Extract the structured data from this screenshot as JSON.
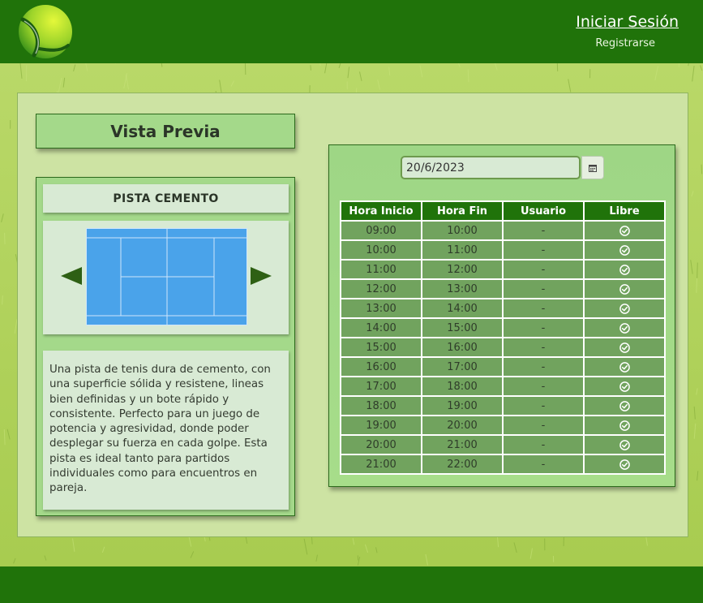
{
  "header": {
    "login_label": "Iniciar Sesión",
    "register_label": "Registrarse",
    "logo_icon": "tennis-ball-icon"
  },
  "colors": {
    "header_bg": "#20730a",
    "panel_bg": "#cde3a3",
    "card_bg": "#a4d98a",
    "table_header_bg": "#20730a",
    "table_cell_bg": "#71a35e",
    "court_blue": "#4aa3ea"
  },
  "preview": {
    "title": "Vista Previa",
    "court_name": "PISTA CEMENTO",
    "description": "Una pista de tenis dura de cemento, con una superficie sólida y resistene, lineas bien definidas y un bote rápido y consistente. Perfecto para un juego de potencia y agresividad, donde poder desplegar su fuerza en cada golpe. Esta pista es ideal tanto para partidos individuales como para encuentros en pareja.",
    "prev_icon": "arrow-left-icon",
    "next_icon": "arrow-right-icon"
  },
  "schedule": {
    "date_value": "20/6/2023",
    "calendar_icon": "calendar-icon",
    "columns": [
      "Hora Inicio",
      "Hora Fin",
      "Usuario",
      "Libre"
    ],
    "rows": [
      {
        "start": "09:00",
        "end": "10:00",
        "user": "-",
        "free": true
      },
      {
        "start": "10:00",
        "end": "11:00",
        "user": "-",
        "free": true
      },
      {
        "start": "11:00",
        "end": "12:00",
        "user": "-",
        "free": true
      },
      {
        "start": "12:00",
        "end": "13:00",
        "user": "-",
        "free": true
      },
      {
        "start": "13:00",
        "end": "14:00",
        "user": "-",
        "free": true
      },
      {
        "start": "14:00",
        "end": "15:00",
        "user": "-",
        "free": true
      },
      {
        "start": "15:00",
        "end": "16:00",
        "user": "-",
        "free": true
      },
      {
        "start": "16:00",
        "end": "17:00",
        "user": "-",
        "free": true
      },
      {
        "start": "17:00",
        "end": "18:00",
        "user": "-",
        "free": true
      },
      {
        "start": "18:00",
        "end": "19:00",
        "user": "-",
        "free": true
      },
      {
        "start": "19:00",
        "end": "20:00",
        "user": "-",
        "free": true
      },
      {
        "start": "20:00",
        "end": "21:00",
        "user": "-",
        "free": true
      },
      {
        "start": "21:00",
        "end": "22:00",
        "user": "-",
        "free": true
      }
    ]
  }
}
